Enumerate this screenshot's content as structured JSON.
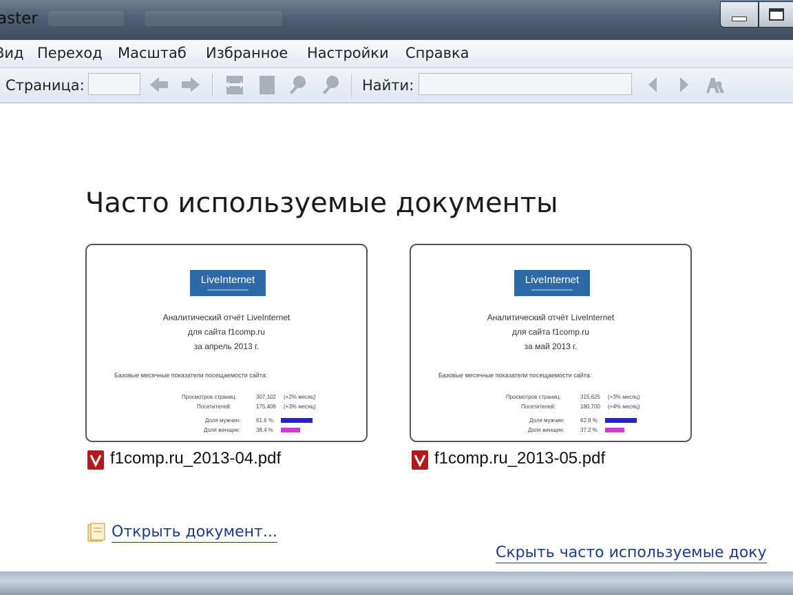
{
  "window": {
    "title": "aster"
  },
  "menu": [
    "Вид",
    "Переход",
    "Масштаб",
    "Избранное",
    "Настройки",
    "Справка"
  ],
  "toolbar": {
    "page_label": "Страница:",
    "page_value": "",
    "find_label": "Найти:",
    "find_value": "",
    "icons": [
      "arrow-left-icon",
      "arrow-right-icon",
      "fit-width-icon",
      "fit-page-icon",
      "zoom-in-icon",
      "zoom-out-icon",
      "find-prev-icon",
      "find-next-icon",
      "match-case-icon"
    ]
  },
  "main": {
    "heading": "Часто используемые документы",
    "documents": [
      {
        "filename": "f1comp.ru_2013-04.pdf",
        "thumb": {
          "logo": "LiveInternet",
          "line1": "Аналитический отчёт LiveInternet",
          "line2": "для сайта f1comp.ru",
          "line3": "за апрель 2013 г.",
          "section": "Базовые месячные показатели посещаемости сайта:",
          "rows": [
            {
              "label": "Просмотров страниц:",
              "value": "307,102",
              "note": "(+2% месяц)"
            },
            {
              "label": "Посетителей:",
              "value": "175,406",
              "note": "(+3% месяц)"
            }
          ],
          "shares": [
            {
              "label": "Доля мужчин:",
              "value": "61.6 %",
              "fraction": 0.616,
              "color": "#2424c8"
            },
            {
              "label": "Доля женщин:",
              "value": "38.4 %",
              "fraction": 0.384,
              "color": "#d43ad4"
            }
          ]
        }
      },
      {
        "filename": "f1comp.ru_2013-05.pdf",
        "thumb": {
          "logo": "LiveInternet",
          "line1": "Аналитический отчёт LiveInternet",
          "line2": "для сайта f1comp.ru",
          "line3": "за май 2013 г.",
          "section": "Базовые месячные показатели посещаемости сайта:",
          "rows": [
            {
              "label": "Просмотров страниц:",
              "value": "315,625",
              "note": "(+3% месяц)"
            },
            {
              "label": "Посетителей:",
              "value": "180,700",
              "note": "(+4% месяц)"
            }
          ],
          "shares": [
            {
              "label": "Доля мужчин:",
              "value": "62.8 %",
              "fraction": 0.628,
              "color": "#2424c8"
            },
            {
              "label": "Доля женщин:",
              "value": "37.2 %",
              "fraction": 0.372,
              "color": "#d43ad4"
            }
          ]
        }
      }
    ],
    "open_link": "Открыть документ...",
    "hide_link": "Скрыть часто используемые доку"
  },
  "colors": {
    "link": "#1c3d88",
    "logo_blue": "#2e6aa8",
    "pdf_red": "#b01c1c"
  }
}
